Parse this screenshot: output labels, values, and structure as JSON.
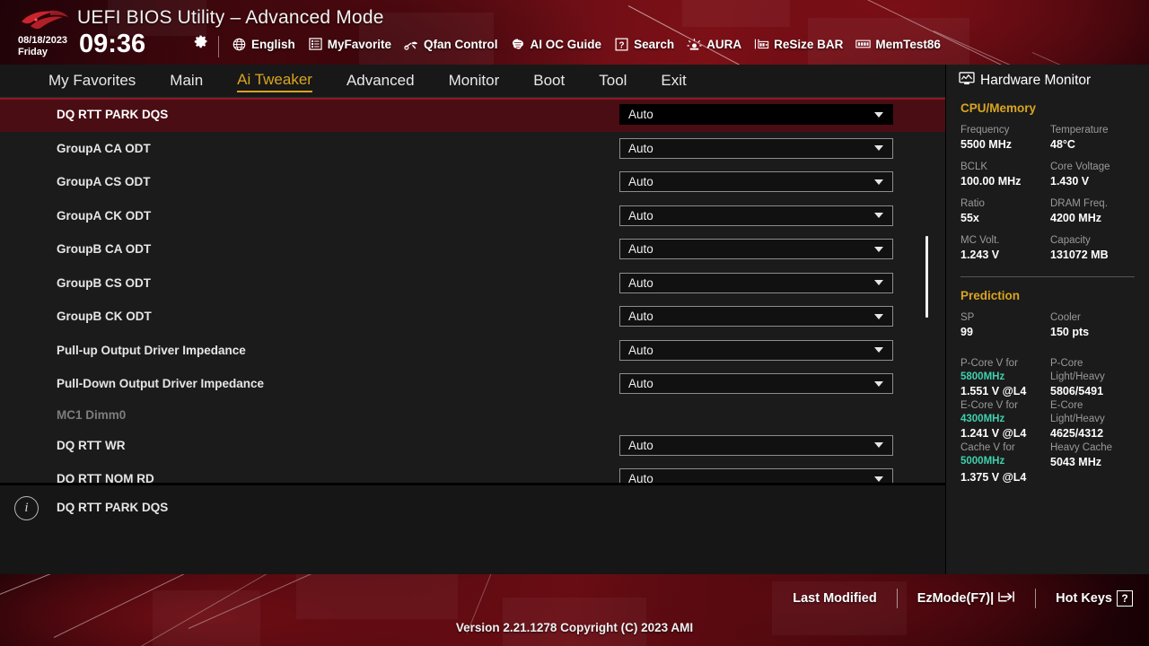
{
  "header": {
    "title": "UEFI BIOS Utility – Advanced Mode",
    "date": "08/18/2023",
    "weekday": "Friday",
    "time": "09:36",
    "gear_icon": "gear-icon",
    "logo_name": "rog-logo",
    "toolbar": [
      {
        "label": "English",
        "icon": "globe-icon"
      },
      {
        "label": "MyFavorite",
        "icon": "star-list-icon"
      },
      {
        "label": "Qfan Control",
        "icon": "fan-icon"
      },
      {
        "label": "AI OC Guide",
        "icon": "brain-icon"
      },
      {
        "label": "Search",
        "icon": "question-box-icon"
      },
      {
        "label": "AURA",
        "icon": "light-icon"
      },
      {
        "label": "ReSize BAR",
        "icon": "resize-bar-icon"
      },
      {
        "label": "MemTest86",
        "icon": "memory-icon"
      }
    ]
  },
  "nav": {
    "tabs": [
      {
        "label": "My Favorites",
        "active": false
      },
      {
        "label": "Main",
        "active": false
      },
      {
        "label": "Ai Tweaker",
        "active": true
      },
      {
        "label": "Advanced",
        "active": false
      },
      {
        "label": "Monitor",
        "active": false
      },
      {
        "label": "Boot",
        "active": false
      },
      {
        "label": "Tool",
        "active": false
      },
      {
        "label": "Exit",
        "active": false
      }
    ],
    "active_color": "#d9a520"
  },
  "settings": {
    "rows": [
      {
        "label": "DQ RTT PARK DQS",
        "value": "Auto",
        "type": "combo",
        "selected": true
      },
      {
        "label": "GroupA CA ODT",
        "value": "Auto",
        "type": "combo",
        "selected": false
      },
      {
        "label": "GroupA CS ODT",
        "value": "Auto",
        "type": "combo",
        "selected": false
      },
      {
        "label": "GroupA CK ODT",
        "value": "Auto",
        "type": "combo",
        "selected": false
      },
      {
        "label": "GroupB CA ODT",
        "value": "Auto",
        "type": "combo",
        "selected": false
      },
      {
        "label": "GroupB CS ODT",
        "value": "Auto",
        "type": "combo",
        "selected": false
      },
      {
        "label": "GroupB CK ODT",
        "value": "Auto",
        "type": "combo",
        "selected": false
      },
      {
        "label": "Pull-up Output Driver Impedance",
        "value": "Auto",
        "type": "combo",
        "selected": false
      },
      {
        "label": "Pull-Down Output Driver Impedance",
        "value": "Auto",
        "type": "combo",
        "selected": false
      },
      {
        "label": "MC1 Dimm0",
        "value": "",
        "type": "header",
        "selected": false
      },
      {
        "label": "DQ RTT WR",
        "value": "Auto",
        "type": "combo",
        "selected": false
      },
      {
        "label": "DQ RTT NOM RD",
        "value": "Auto",
        "type": "combo",
        "selected": false
      }
    ],
    "selected_bg": "#4a0d14",
    "scroll_thumb_top_pct": 36,
    "scroll_thumb_height_pct": 21
  },
  "description": {
    "icon": "info-icon",
    "text": "DQ RTT PARK DQS"
  },
  "hardware_monitor": {
    "title": "Hardware Monitor",
    "title_icon": "monitor-icon",
    "sections": [
      {
        "name": "CPU/Memory",
        "entries": [
          {
            "key": "Frequency",
            "value": "5500 MHz"
          },
          {
            "key": "Temperature",
            "value": "48°C"
          },
          {
            "key": "BCLK",
            "value": "100.00 MHz"
          },
          {
            "key": "Core Voltage",
            "value": "1.430 V"
          },
          {
            "key": "Ratio",
            "value": "55x"
          },
          {
            "key": "DRAM Freq.",
            "value": "4200 MHz"
          },
          {
            "key": "MC Volt.",
            "value": "1.243 V"
          },
          {
            "key": "Capacity",
            "value": "131072 MB"
          }
        ]
      },
      {
        "name": "Prediction",
        "entries": [
          {
            "key": "SP",
            "value": "99"
          },
          {
            "key": "Cooler",
            "value": "150 pts"
          }
        ],
        "detail": [
          {
            "key": "P-Core V for",
            "key2": "5800MHz",
            "value": "1.551 V @L4",
            "key_r": "P-Core",
            "key2_r": "Light/Heavy",
            "value_r": "5806/5491"
          },
          {
            "key": "E-Core V for",
            "key2": "4300MHz",
            "value": "1.241 V @L4",
            "key_r": "E-Core",
            "key2_r": "Light/Heavy",
            "value_r": "4625/4312"
          },
          {
            "key": "Cache V for",
            "key2": "5000MHz",
            "value": "1.375 V @L4",
            "key_r": "Heavy Cache",
            "key2_r": "",
            "value_r": "5043 MHz"
          }
        ]
      }
    ],
    "accent_color": "#d9a520",
    "teal_color": "#3fd0ae"
  },
  "footer": {
    "links": [
      {
        "label": "Last Modified",
        "icon": ""
      },
      {
        "label": "EzMode(F7)|",
        "icon": "arrow-into-bracket-icon"
      },
      {
        "label": "Hot Keys",
        "icon": "question-box-icon"
      }
    ],
    "hotkey_glyph": "?",
    "version": "Version 2.21.1278 Copyright (C) 2023 AMI"
  }
}
